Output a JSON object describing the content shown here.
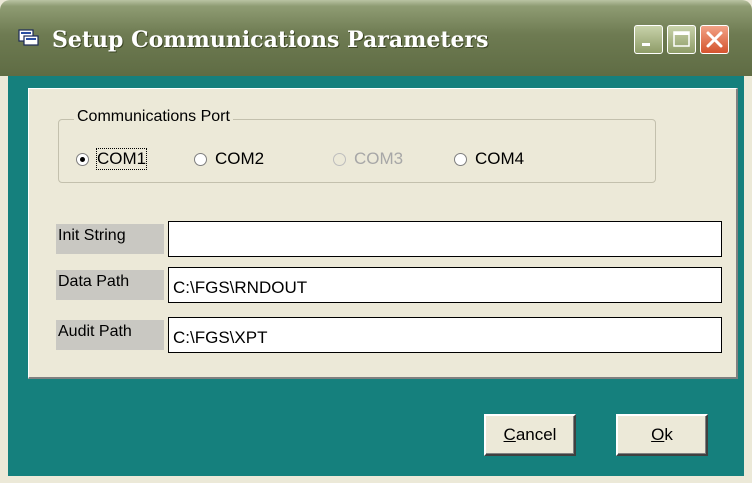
{
  "window": {
    "title": "Setup Communications Parameters",
    "colors": {
      "titlebar": "#6e7b52",
      "client_background": "#15807d",
      "panel": "#ece9d8"
    }
  },
  "title_buttons": [
    {
      "name": "minimize",
      "icon": "minimize-icon"
    },
    {
      "name": "maximize",
      "icon": "maximize-icon"
    },
    {
      "name": "close",
      "icon": "close-icon"
    }
  ],
  "comm_port": {
    "legend": "Communications Port",
    "options": [
      {
        "label": "COM1",
        "checked": true,
        "enabled": true
      },
      {
        "label": "COM2",
        "checked": false,
        "enabled": true
      },
      {
        "label": "COM3",
        "checked": false,
        "enabled": false
      },
      {
        "label": "COM4",
        "checked": false,
        "enabled": true
      }
    ]
  },
  "fields": {
    "init_string": {
      "label": "Init String",
      "value": ""
    },
    "data_path": {
      "label": "Data Path",
      "value": "C:\\FGS\\RNDOUT"
    },
    "audit_path": {
      "label": "Audit Path",
      "value": "C:\\FGS\\XPT"
    }
  },
  "buttons": {
    "cancel": {
      "mnemonic": "C",
      "rest": "ancel"
    },
    "ok": {
      "mnemonic": "O",
      "rest": "k"
    }
  }
}
